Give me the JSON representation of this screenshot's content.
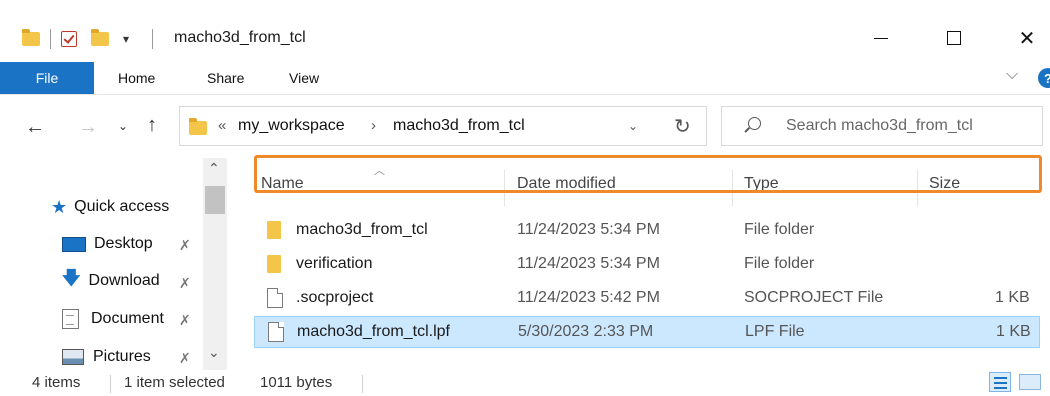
{
  "window": {
    "title": "macho3d_from_tcl",
    "quick_access_toolbar_arrow": "▾",
    "minimize_label": "",
    "maximize_label": "",
    "close_label": "✕"
  },
  "ribbon": {
    "tabs": [
      {
        "label": "File",
        "active": true
      },
      {
        "label": "Home"
      },
      {
        "label": "Share"
      },
      {
        "label": "View"
      }
    ],
    "expand_glyph": "⌵",
    "help_glyph": "?",
    "accent_color": "#1a73c4"
  },
  "navigation": {
    "back": "←",
    "forward": "→",
    "recent": "⌄",
    "up": "↑"
  },
  "address_bar": {
    "overflow": "«",
    "breadcrumbs": [
      "my_workspace",
      "macho3d_from_tcl"
    ],
    "separator": "›",
    "dropdown": "⌄",
    "refresh": "↻"
  },
  "search": {
    "placeholder": "Search macho3d_from_tcl"
  },
  "nav_pane": {
    "items": [
      {
        "label": "Quick access",
        "icon": "star-icon"
      },
      {
        "label": "Desktop",
        "icon": "desktop-icon",
        "pinned": true
      },
      {
        "label": "Download",
        "icon": "download-icon",
        "pinned": true
      },
      {
        "label": "Document",
        "icon": "document-icon",
        "pinned": true
      },
      {
        "label": "Pictures",
        "icon": "pictures-icon",
        "pinned": true
      }
    ],
    "pin_glyph": "📌"
  },
  "file_list": {
    "columns": [
      "Name",
      "Date modified",
      "Type",
      "Size"
    ],
    "rows": [
      {
        "name": "macho3d_from_tcl",
        "date": "11/24/2023 5:34 PM",
        "type": "File folder",
        "size": "",
        "icon": "folder-icon"
      },
      {
        "name": "verification",
        "date": "11/24/2023 5:34 PM",
        "type": "File folder",
        "size": "",
        "icon": "folder-icon"
      },
      {
        "name": ".socproject",
        "date": "11/24/2023 5:42 PM",
        "type": "SOCPROJECT File",
        "size": "1 KB",
        "icon": "file-icon"
      },
      {
        "name": "macho3d_from_tcl.lpf",
        "date": "5/30/2023 2:33 PM",
        "type": "LPF File",
        "size": "1 KB",
        "icon": "file-icon",
        "selected": true
      }
    ],
    "highlight_color": "#ef8a2a",
    "selection_color": "#cce8ff"
  },
  "status_bar": {
    "item_count": "4 items",
    "selection": "1 item selected",
    "selection_size": "1011 bytes"
  }
}
